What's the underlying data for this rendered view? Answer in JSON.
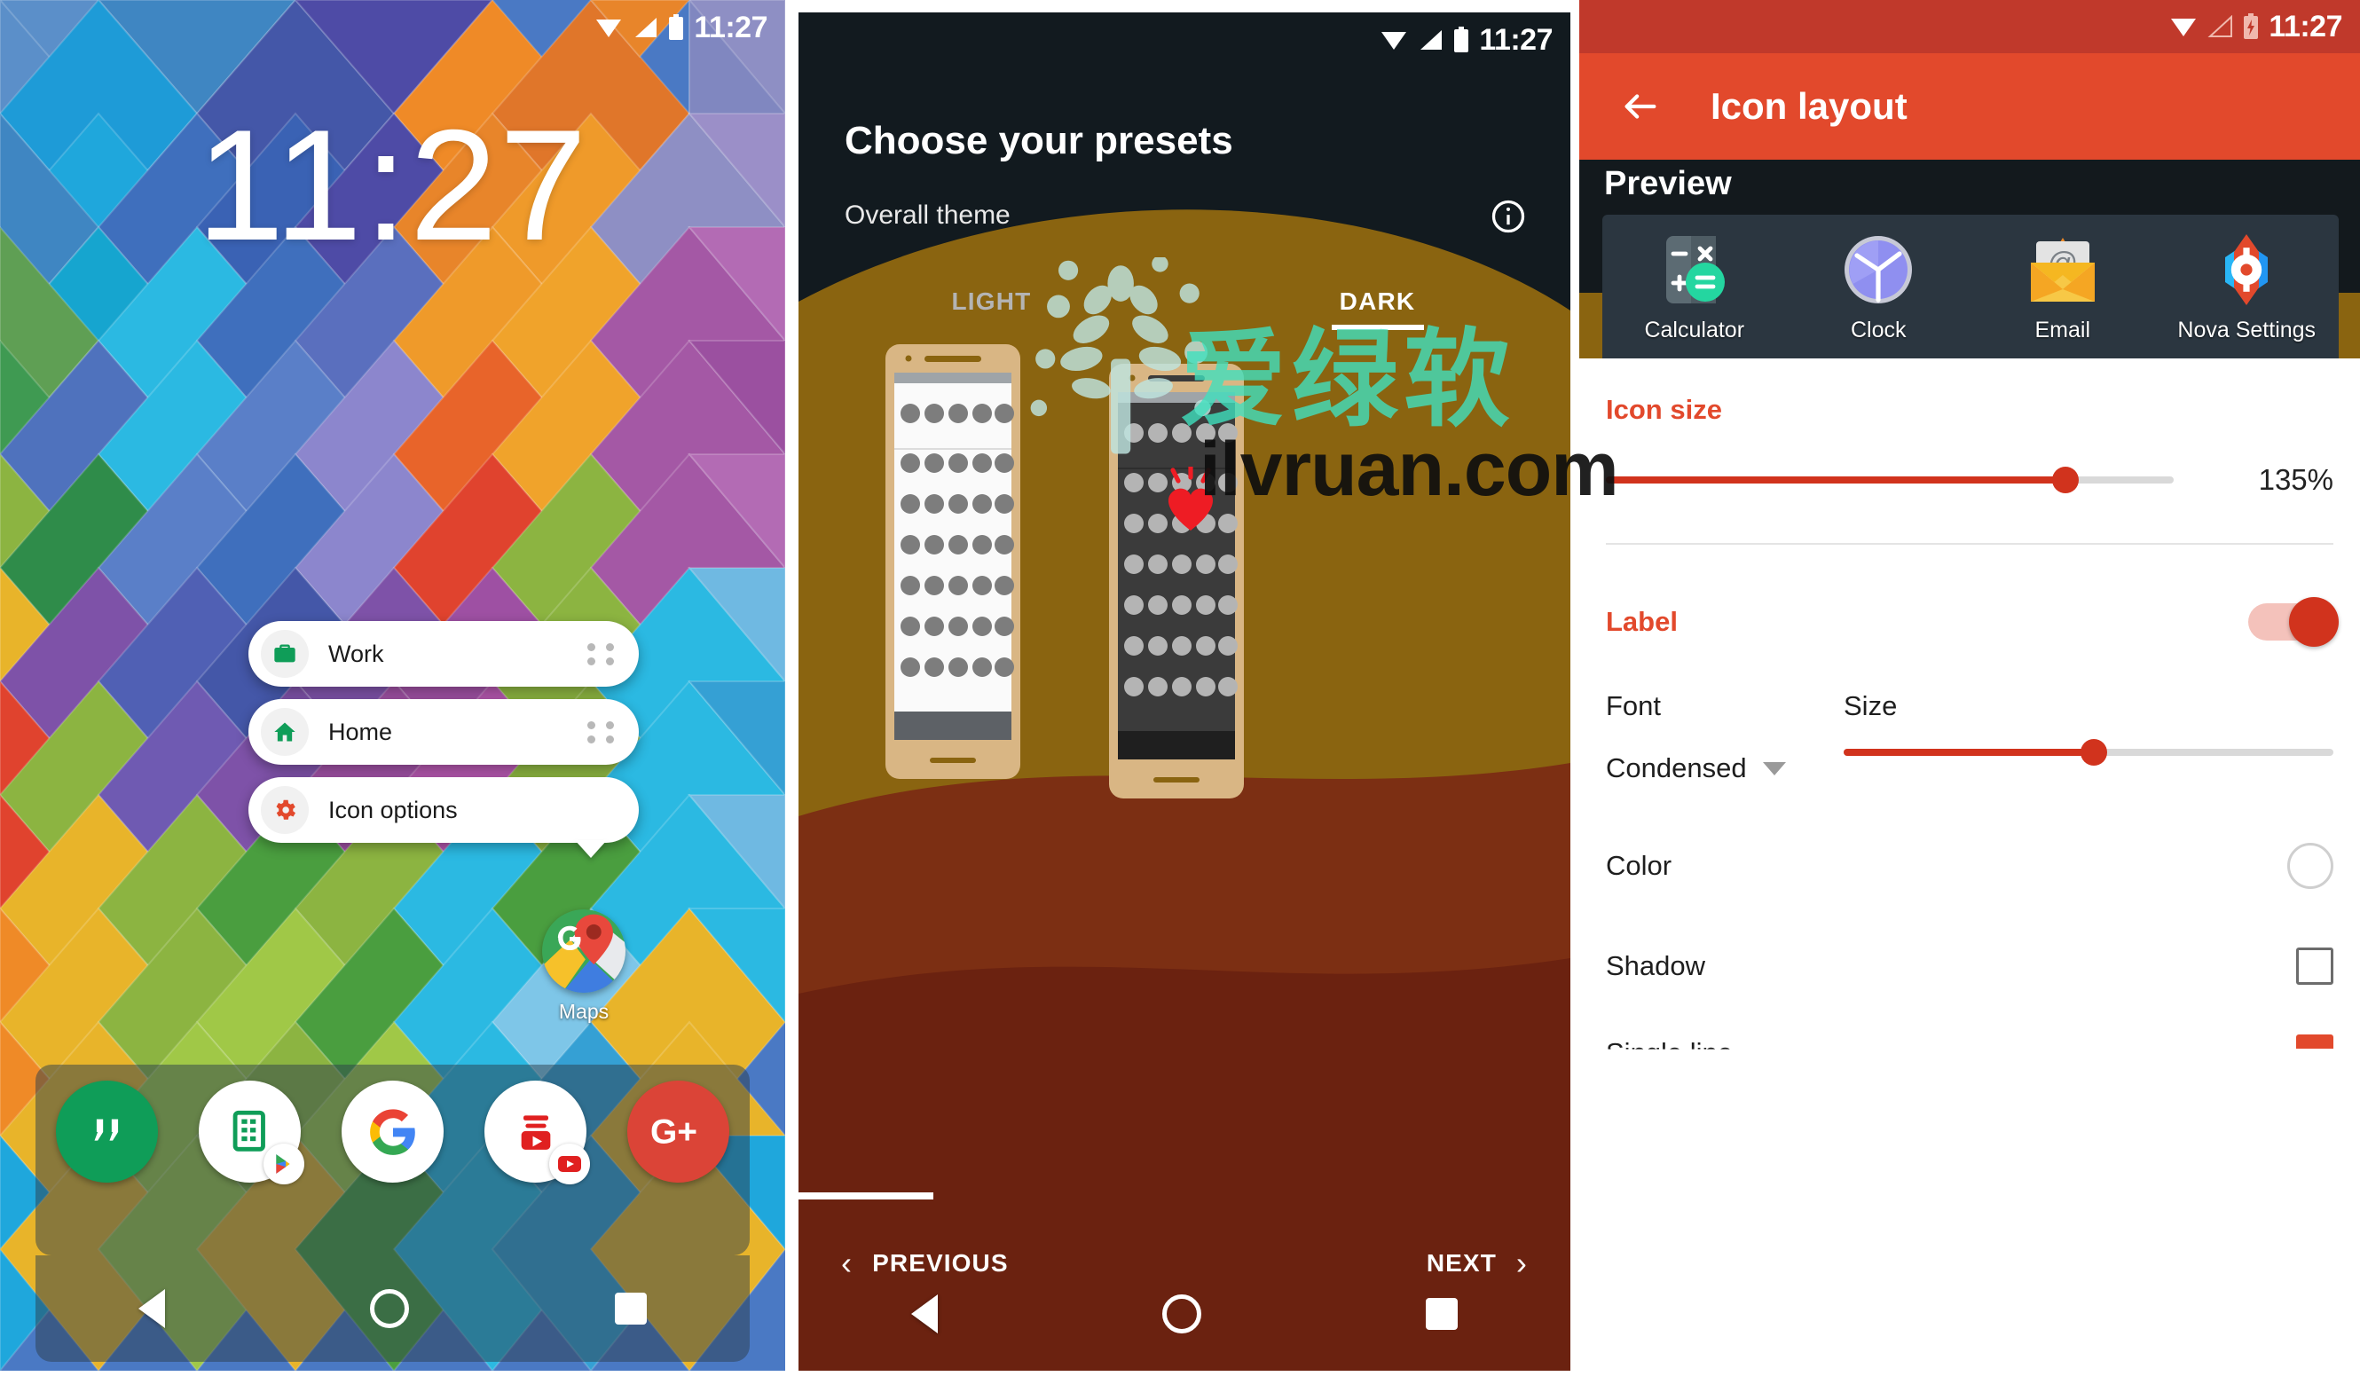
{
  "common": {
    "status_time": "11:27"
  },
  "panel_home": {
    "name": "home-screen",
    "clock": "11:27",
    "popup_items": [
      {
        "label": "Work",
        "icon": "briefcase-icon",
        "color": "#0f9d58"
      },
      {
        "label": "Home",
        "icon": "house-icon",
        "color": "#0f9d58"
      },
      {
        "label": "Icon options",
        "icon": "gear-icon",
        "color": "#e2492c"
      }
    ],
    "desktop_app": {
      "label": "Maps",
      "icon": "google-maps-icon"
    },
    "dock": [
      {
        "label": "Hangouts",
        "icon": "hangouts-icon",
        "color": "#0f9d58"
      },
      {
        "label": "Sheets",
        "icon": "sheets-icon",
        "color": "#ffffff",
        "badge": "play-store-icon"
      },
      {
        "label": "Google",
        "icon": "google-g-icon",
        "color": "#ffffff"
      },
      {
        "label": "YouTube Music",
        "icon": "youtube-icon",
        "color": "#ffffff",
        "badge": "youtube-badge-icon"
      },
      {
        "label": "Google Plus",
        "icon": "google-plus-icon",
        "color": "#db4437"
      }
    ],
    "nav": [
      "back-button",
      "home-button",
      "recents-button"
    ]
  },
  "panel_presets": {
    "title": "Choose your presets",
    "subtitle": "Overall theme",
    "info_icon": "info-icon",
    "tabs": [
      {
        "label": "LIGHT",
        "selected": false
      },
      {
        "label": "DARK",
        "selected": true
      }
    ],
    "previous_label": "PREVIOUS",
    "next_label": "NEXT",
    "nav": [
      "back-button",
      "home-button",
      "recents-button"
    ]
  },
  "panel_icon_layout": {
    "title": "Icon layout",
    "back_icon": "back-arrow-icon",
    "preview_label": "Preview",
    "preview_apps": [
      {
        "label": "Calculator",
        "icon": "calculator-icon"
      },
      {
        "label": "Clock",
        "icon": "clock-icon"
      },
      {
        "label": "Email",
        "icon": "email-icon"
      },
      {
        "label": "Nova Settings",
        "icon": "nova-settings-icon"
      }
    ],
    "icon_size": {
      "section_label": "Icon size",
      "value": "135%",
      "percent": 70
    },
    "label_section": {
      "section_label": "Label",
      "toggle_on": true,
      "font_label": "Font",
      "font_value": "Condensed",
      "size_label": "Size",
      "size_percent": 51,
      "color_label": "Color",
      "shadow_label": "Shadow",
      "shadow_checked": false,
      "partial_row_label": "Single line",
      "partial_row_checked": true
    },
    "accent_color": "#e2492c",
    "appbar_color": "#e2492c",
    "statusbar_color": "#c0392b"
  },
  "watermark": {
    "text_cn": "爱绿软",
    "text_url": "ilvruan.com"
  },
  "chart_data": null
}
